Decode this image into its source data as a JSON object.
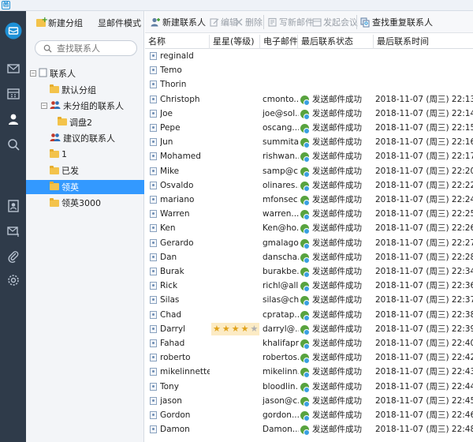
{
  "app": {
    "mark": "邑"
  },
  "groups_panel": {
    "new_group": "新建分组",
    "show_mail_mode": "显邮件模式",
    "search_placeholder": "查找联系人",
    "tree": [
      {
        "label": "联系人",
        "level": 0,
        "toggle": "-",
        "kind": "book"
      },
      {
        "label": "默认分组",
        "level": 1,
        "kind": "folder"
      },
      {
        "label": "未分组的联系人",
        "level": 1,
        "toggle": "-",
        "kind": "people"
      },
      {
        "label": "调盘2",
        "level": 2,
        "kind": "folder"
      },
      {
        "label": "建议的联系人",
        "level": 1,
        "kind": "people"
      },
      {
        "label": "1",
        "level": 1,
        "kind": "folder"
      },
      {
        "label": "已发",
        "level": 1,
        "kind": "folder"
      },
      {
        "label": "领英",
        "level": 1,
        "kind": "folder",
        "selected": true
      },
      {
        "label": "领英3000",
        "level": 1,
        "kind": "folder"
      }
    ]
  },
  "toolbar": {
    "new_contact": "新建联系人",
    "edit": "编辑",
    "delete": "删除",
    "compose": "写新邮件",
    "meeting": "发起会议",
    "find_duplicates": "查找重复联系人"
  },
  "columns": [
    "名称",
    "星星(等级)",
    "电子邮件",
    "最后联系状态",
    "最后联系时间"
  ],
  "rows": [
    {
      "name": "reginald",
      "email": "",
      "status": "",
      "time": ""
    },
    {
      "name": "Temo",
      "email": "",
      "status": "",
      "time": ""
    },
    {
      "name": "Thorin",
      "email": "",
      "status": "",
      "time": ""
    },
    {
      "name": "Christoph",
      "email": "cmonto...",
      "status": "发送邮件成功",
      "time": "2018-11-07 (周三) 22:13"
    },
    {
      "name": "Joe",
      "email": "joe@sol...",
      "status": "发送邮件成功",
      "time": "2018-11-07 (周三) 22:14"
    },
    {
      "name": "Pepe",
      "email": "oscang...",
      "status": "发送邮件成功",
      "time": "2018-11-07 (周三) 22:15"
    },
    {
      "name": "Jun",
      "email": "summita...",
      "status": "发送邮件成功",
      "time": "2018-11-07 (周三) 22:16"
    },
    {
      "name": "Mohamed",
      "email": "rishwan...",
      "status": "发送邮件成功",
      "time": "2018-11-07 (周三) 22:17"
    },
    {
      "name": "Mike",
      "email": "samp@c...",
      "status": "发送邮件成功",
      "time": "2018-11-07 (周三) 22:20"
    },
    {
      "name": "Osvaldo",
      "email": "olinares...",
      "status": "发送邮件成功",
      "time": "2018-11-07 (周三) 22:22"
    },
    {
      "name": "mariano",
      "email": "mfonsec...",
      "status": "发送邮件成功",
      "time": "2018-11-07 (周三) 22:24"
    },
    {
      "name": "Warren",
      "email": "warren...",
      "status": "发送邮件成功",
      "time": "2018-11-07 (周三) 22:25"
    },
    {
      "name": "Ken",
      "email": "Ken@ho...",
      "status": "发送邮件成功",
      "time": "2018-11-07 (周三) 22:26"
    },
    {
      "name": "Gerardo",
      "email": "gmalago...",
      "status": "发送邮件成功",
      "time": "2018-11-07 (周三) 22:27"
    },
    {
      "name": "Dan",
      "email": "danscha...",
      "status": "发送邮件成功",
      "time": "2018-11-07 (周三) 22:28"
    },
    {
      "name": "Burak",
      "email": "burakbe...",
      "status": "发送邮件成功",
      "time": "2018-11-07 (周三) 22:34"
    },
    {
      "name": "Rick",
      "email": "richl@all...",
      "status": "发送邮件成功",
      "time": "2018-11-07 (周三) 22:36"
    },
    {
      "name": "Silas",
      "email": "silas@ch...",
      "status": "发送邮件成功",
      "time": "2018-11-07 (周三) 22:37"
    },
    {
      "name": "Chad",
      "email": "cpratap...",
      "status": "发送邮件成功",
      "time": "2018-11-07 (周三) 22:38"
    },
    {
      "name": "Darryl",
      "email": "darryl@...",
      "status": "发送邮件成功",
      "time": "2018-11-07 (周三) 22:39",
      "stars": 4
    },
    {
      "name": "Fahad",
      "email": "khalifapr...",
      "status": "发送邮件成功",
      "time": "2018-11-07 (周三) 22:40"
    },
    {
      "name": "roberto",
      "email": "robertos...",
      "status": "发送邮件成功",
      "time": "2018-11-07 (周三) 22:42"
    },
    {
      "name": "mikelinnette",
      "email": "mikelinn...",
      "status": "发送邮件成功",
      "time": "2018-11-07 (周三) 22:43"
    },
    {
      "name": "Tony",
      "email": "bloodlin...",
      "status": "发送邮件成功",
      "time": "2018-11-07 (周三) 22:44"
    },
    {
      "name": "jason",
      "email": "jason@c...",
      "status": "发送邮件成功",
      "time": "2018-11-07 (周三) 22:45"
    },
    {
      "name": "Gordon",
      "email": "gordon...",
      "status": "发送邮件成功",
      "time": "2018-11-07 (周三) 22:46"
    },
    {
      "name": "Damon",
      "email": "Damon...",
      "status": "发送邮件成功",
      "time": "2018-11-07 (周三) 22:48"
    }
  ],
  "colors": {
    "rail": "#2f3b4a",
    "accent": "#1e90d6",
    "selection": "#3399ff",
    "star": "#e0a21a",
    "status_green": "#58a33f"
  }
}
